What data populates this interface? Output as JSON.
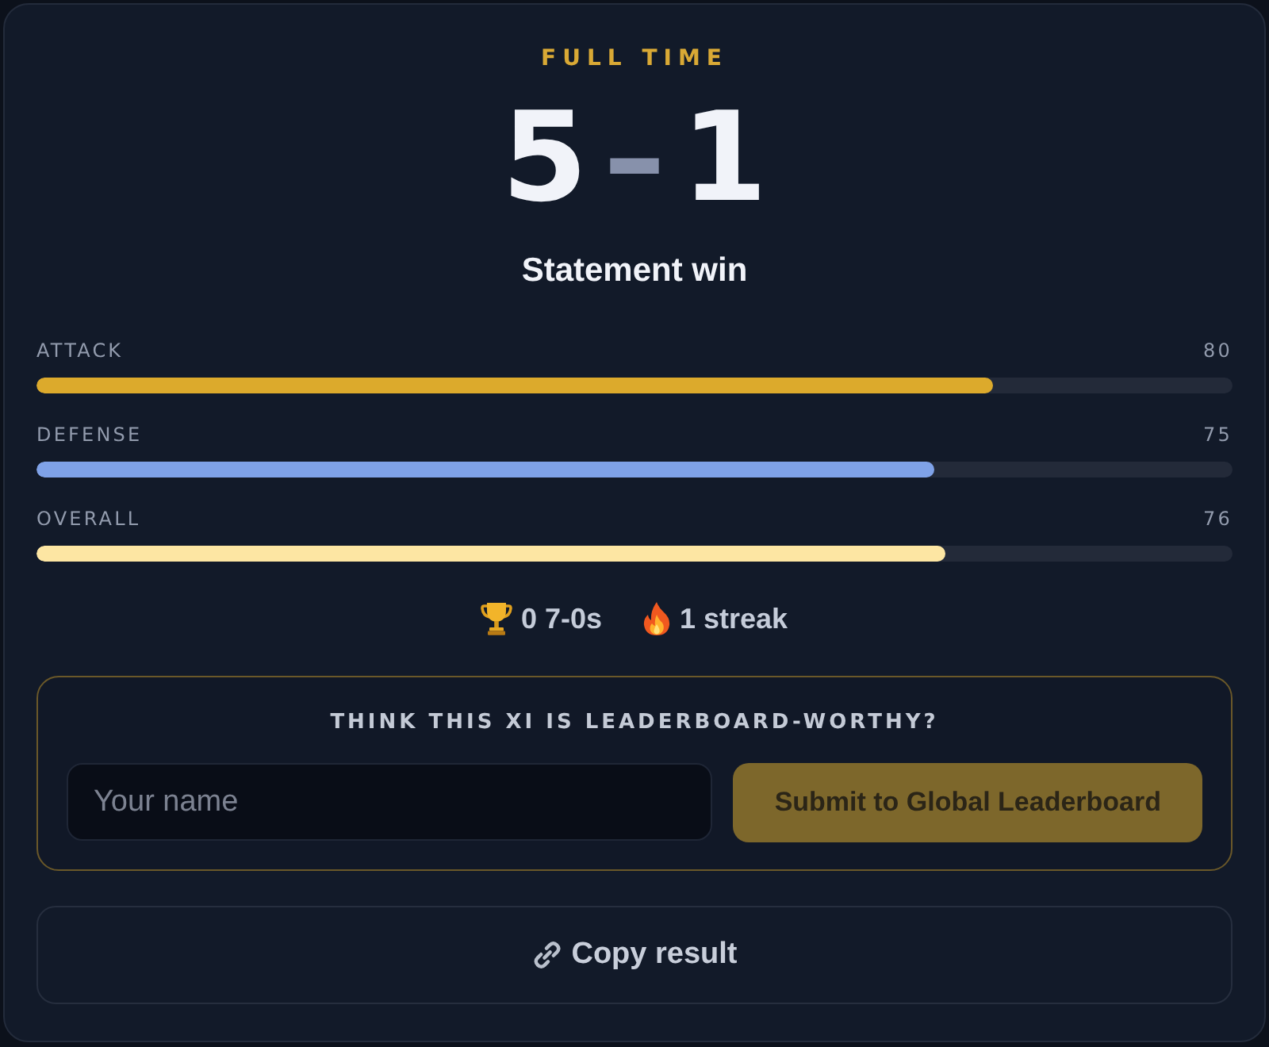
{
  "header": {
    "label": "FULL TIME"
  },
  "score": {
    "home": "5",
    "separator": "–",
    "away": "1"
  },
  "verdict": "Statement win",
  "stats": [
    {
      "label": "ATTACK",
      "value": "80",
      "level": 0.8,
      "color": "#dcaa2c"
    },
    {
      "label": "DEFENSE",
      "value": "75",
      "level": 0.75,
      "color": "#7fa2e8"
    },
    {
      "label": "OVERALL",
      "value": "76",
      "level": 0.76,
      "color": "#fde6a3"
    }
  ],
  "records": [
    {
      "kind": "trophy",
      "text": "0 7-0s"
    },
    {
      "kind": "flame",
      "text": "1 streak"
    }
  ],
  "leaderboard": {
    "prompt": "THINK THIS XI IS LEADERBOARD-WORTHY?",
    "name_field": {
      "placeholder": "Your name"
    },
    "submit_button": {
      "label": "Submit to Global Leaderboard",
      "disabled": true
    }
  },
  "copy_button": {
    "label": "Copy result"
  }
}
